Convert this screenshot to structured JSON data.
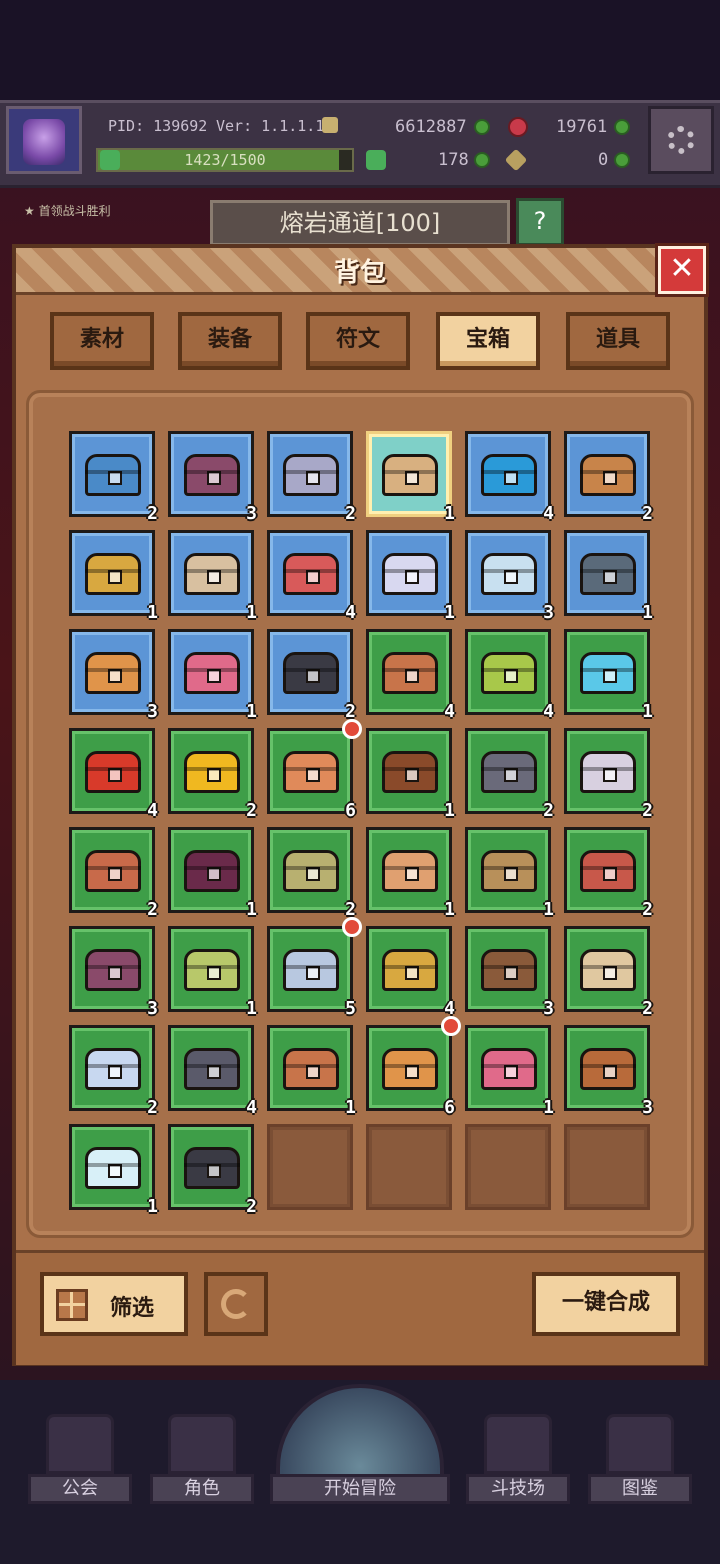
{
  "hud": {
    "pid": "PID: 139692",
    "version": "Ver: 1.1.1.13",
    "gold": "6612887",
    "gems": "19761",
    "exp_text": "1423/1500",
    "exp_fraction": 0.949,
    "clover_count": "178",
    "key_count": "0"
  },
  "quest": {
    "text": "首领战斗胜利"
  },
  "stage": {
    "name": "熔岩通道[100]",
    "help_label": "帮助"
  },
  "panel": {
    "title": "背包",
    "close_label": "✕"
  },
  "tabs": [
    {
      "label": "素材",
      "active": false
    },
    {
      "label": "装备",
      "active": false
    },
    {
      "label": "符文",
      "active": false
    },
    {
      "label": "宝箱",
      "active": true
    },
    {
      "label": "道具",
      "active": false
    }
  ],
  "items": [
    {
      "bg": "blue",
      "color": "#4a8ac8",
      "count": "2"
    },
    {
      "bg": "blue",
      "color": "#8a4a6a",
      "count": "3"
    },
    {
      "bg": "blue",
      "color": "#a8a8c8",
      "count": "2"
    },
    {
      "bg": "gold",
      "color": "#d8b080",
      "count": "1"
    },
    {
      "bg": "blue",
      "color": "#2a9ad8",
      "count": "4"
    },
    {
      "bg": "blue",
      "color": "#c8844a",
      "count": "2"
    },
    {
      "bg": "blue",
      "color": "#d8a840",
      "count": "1"
    },
    {
      "bg": "blue",
      "color": "#d8c0a0",
      "count": "1"
    },
    {
      "bg": "blue",
      "color": "#d85a5a",
      "count": "4"
    },
    {
      "bg": "blue",
      "color": "#d8d8f0",
      "count": "1"
    },
    {
      "bg": "blue",
      "color": "#c8e0f0",
      "count": "3"
    },
    {
      "bg": "blue",
      "color": "#5a6a7a",
      "count": "1"
    },
    {
      "bg": "blue",
      "color": "#e0944a",
      "count": "3"
    },
    {
      "bg": "blue",
      "color": "#e06a8a",
      "count": "1"
    },
    {
      "bg": "blue",
      "color": "#3a3a44",
      "count": "2"
    },
    {
      "bg": "green",
      "color": "#c8744a",
      "count": "4"
    },
    {
      "bg": "green",
      "color": "#a8c84a",
      "count": "4"
    },
    {
      "bg": "green",
      "color": "#5ac8e8",
      "count": "1"
    },
    {
      "bg": "green",
      "color": "#d83a2a",
      "count": "4"
    },
    {
      "bg": "green",
      "color": "#f0b820",
      "count": "2"
    },
    {
      "bg": "green",
      "color": "#e08a5a",
      "count": "6",
      "dot": true
    },
    {
      "bg": "green",
      "color": "#8a4a2a",
      "count": "1"
    },
    {
      "bg": "green",
      "color": "#6a6a7a",
      "count": "2"
    },
    {
      "bg": "green",
      "color": "#d8d0e0",
      "count": "2"
    },
    {
      "bg": "green",
      "color": "#c86a4a",
      "count": "2"
    },
    {
      "bg": "green",
      "color": "#6a2a4a",
      "count": "1"
    },
    {
      "bg": "green",
      "color": "#b8b070",
      "count": "2"
    },
    {
      "bg": "green",
      "color": "#e0a070",
      "count": "1"
    },
    {
      "bg": "green",
      "color": "#b8905a",
      "count": "1"
    },
    {
      "bg": "green",
      "color": "#c8584a",
      "count": "2"
    },
    {
      "bg": "green",
      "color": "#8a4a6a",
      "count": "3"
    },
    {
      "bg": "green",
      "color": "#b8c86a",
      "count": "1"
    },
    {
      "bg": "green",
      "color": "#b8c8e0",
      "count": "5",
      "dot": true
    },
    {
      "bg": "green",
      "color": "#d8a840",
      "count": "4"
    },
    {
      "bg": "green",
      "color": "#8a5a3a",
      "count": "3"
    },
    {
      "bg": "green",
      "color": "#e0c8a0",
      "count": "2"
    },
    {
      "bg": "green",
      "color": "#c8d8f0",
      "count": "2"
    },
    {
      "bg": "green",
      "color": "#5a5a6a",
      "count": "4"
    },
    {
      "bg": "green",
      "color": "#c8744a",
      "count": "1"
    },
    {
      "bg": "green",
      "color": "#e0944a",
      "count": "6",
      "dot": true
    },
    {
      "bg": "green",
      "color": "#e06a8a",
      "count": "1"
    },
    {
      "bg": "green",
      "color": "#b86a3a",
      "count": "3"
    },
    {
      "bg": "green",
      "color": "#d8f0f8",
      "count": "1"
    },
    {
      "bg": "green",
      "color": "#3a3a44",
      "count": "2"
    },
    {
      "bg": "empty"
    },
    {
      "bg": "empty"
    },
    {
      "bg": "empty"
    },
    {
      "bg": "empty"
    }
  ],
  "actions": {
    "filter_label": "筛选",
    "compose_label": "一键合成"
  },
  "nav": {
    "guild": "公会",
    "character": "角色",
    "adventure": "开始冒险",
    "arena": "斗技场",
    "codex": "图鉴"
  }
}
